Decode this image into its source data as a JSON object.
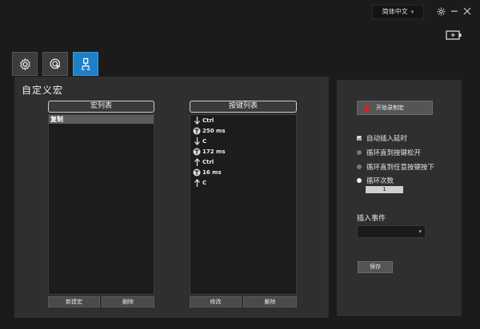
{
  "titlebar": {
    "language": "简体中文"
  },
  "tabs": [
    {
      "icon": "gear-icon",
      "active": false
    },
    {
      "icon": "target-click-icon",
      "active": false
    },
    {
      "icon": "macro-icon",
      "active": true
    }
  ],
  "left": {
    "title": "自定义宏",
    "macro_list": {
      "header": "宏列表",
      "items": [
        "复制"
      ],
      "new_button": "新建宏",
      "delete_button": "删除"
    },
    "key_list": {
      "header": "按键列表",
      "items": [
        {
          "icon": "key-down-arrow-icon",
          "text": "Ctrl"
        },
        {
          "icon": "delay-timer-icon",
          "text": "250 ms"
        },
        {
          "icon": "key-down-arrow-icon",
          "text": "C"
        },
        {
          "icon": "delay-timer-icon",
          "text": "172 ms"
        },
        {
          "icon": "key-up-arrow-icon",
          "text": "Ctrl"
        },
        {
          "icon": "delay-timer-icon",
          "text": "16 ms"
        },
        {
          "icon": "key-up-arrow-icon",
          "text": "C"
        }
      ],
      "modify_button": "修改",
      "delete_button": "删除"
    }
  },
  "right": {
    "record_button": "开始录制宏",
    "auto_delay": "自动插入延时",
    "loop_release": "循环直到按键松开",
    "loop_any": "循环直到任意按键按下",
    "loop_count": "循环次数",
    "loop_count_value": "1",
    "insert_event_label": "插入事件",
    "insert_event_value": "",
    "save_button": "保存"
  },
  "colors": {
    "accent": "#1f7fc8",
    "record": "#e02020",
    "panel": "#2f2f2f",
    "background": "#1b1b1b"
  }
}
